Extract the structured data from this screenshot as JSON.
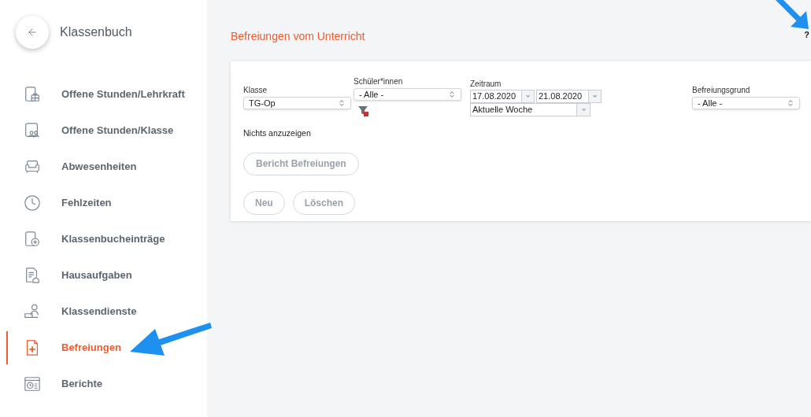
{
  "sidebar": {
    "title": "Klassenbuch",
    "items": [
      {
        "label": "Offene Stunden/Lehrkraft",
        "selected": false
      },
      {
        "label": "Offene Stunden/Klasse",
        "selected": false
      },
      {
        "label": "Abwesenheiten",
        "selected": false
      },
      {
        "label": "Fehlzeiten",
        "selected": false
      },
      {
        "label": "Klassenbucheinträge",
        "selected": false
      },
      {
        "label": "Hausaufgaben",
        "selected": false
      },
      {
        "label": "Klassendienste",
        "selected": false
      },
      {
        "label": "Befreiungen",
        "selected": true
      },
      {
        "label": "Berichte",
        "selected": false
      }
    ]
  },
  "page": {
    "title": "Befreiungen vom Unterricht",
    "help": "?"
  },
  "filters": [
    {
      "kind": "select",
      "label": "Klasse",
      "value": "TG-Op"
    },
    {
      "kind": "select-filter",
      "label": "Schüler*innen",
      "value": "- Alle -"
    },
    {
      "kind": "daterange",
      "label": "Zeitraum",
      "from": "17.08.2020",
      "to": "21.08.2020",
      "preset": "Aktuelle Woche"
    },
    {
      "kind": "select",
      "label": "Befreiungsgrund",
      "value": "- Alle -"
    }
  ],
  "message": "Nichts anzuzeigen",
  "report_button": "Bericht Befreiungen",
  "actions": [
    "Neu",
    "Löschen"
  ]
}
